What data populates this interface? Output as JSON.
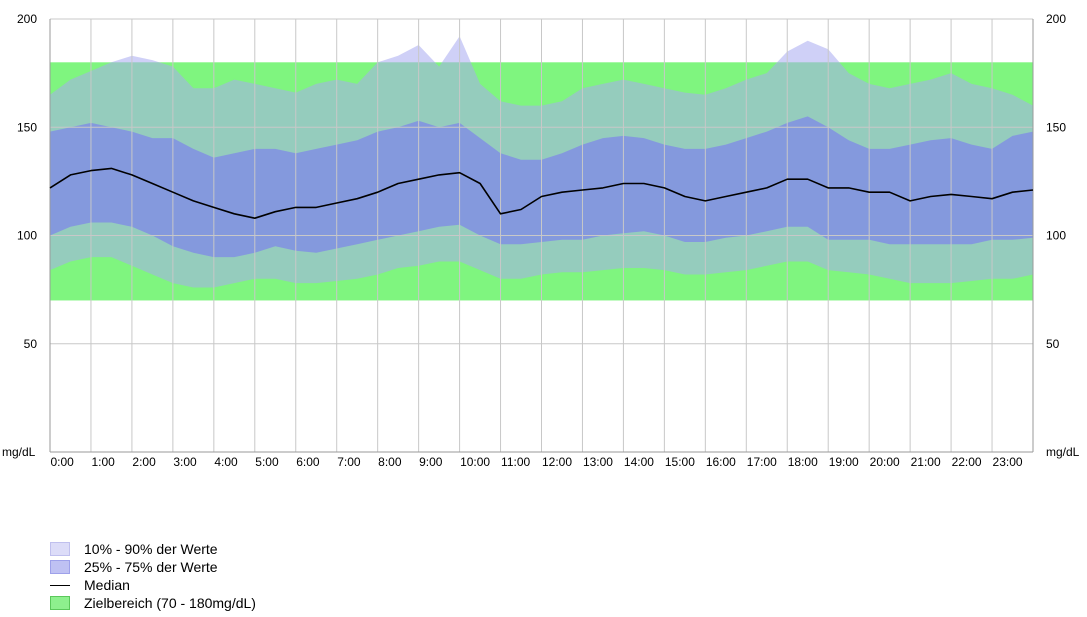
{
  "chart_data": {
    "type": "area",
    "ylim": [
      0,
      200
    ],
    "y_ticks": [
      200,
      150,
      100,
      50
    ],
    "y_unit_label": "mg/dL",
    "x_ticks": [
      "0:00",
      "1:00",
      "2:00",
      "3:00",
      "4:00",
      "5:00",
      "6:00",
      "7:00",
      "8:00",
      "9:00",
      "10:00",
      "11:00",
      "12:00",
      "13:00",
      "14:00",
      "15:00",
      "16:00",
      "17:00",
      "18:00",
      "19:00",
      "20:00",
      "21:00",
      "22:00",
      "23:00"
    ],
    "target_range": [
      70,
      180
    ],
    "hours": [
      0,
      0.5,
      1,
      1.5,
      2,
      2.5,
      3,
      3.5,
      4,
      4.5,
      5,
      5.5,
      6,
      6.5,
      7,
      7.5,
      8,
      8.5,
      9,
      9.5,
      10,
      10.5,
      11,
      11.5,
      12,
      12.5,
      13,
      13.5,
      14,
      14.5,
      15,
      15.5,
      16,
      16.5,
      17,
      17.5,
      18,
      18.5,
      19,
      19.5,
      20,
      20.5,
      21,
      21.5,
      22,
      22.5,
      23,
      23.5,
      24
    ],
    "p90": [
      165,
      172,
      176,
      180,
      183,
      181,
      178,
      168,
      168,
      172,
      170,
      168,
      166,
      170,
      172,
      170,
      180,
      183,
      188,
      178,
      192,
      170,
      162,
      160,
      160,
      162,
      168,
      170,
      172,
      170,
      168,
      166,
      165,
      168,
      172,
      175,
      185,
      190,
      186,
      175,
      170,
      168,
      170,
      172,
      175,
      170,
      168,
      165,
      160
    ],
    "p75": [
      148,
      150,
      152,
      150,
      148,
      145,
      145,
      140,
      136,
      138,
      140,
      140,
      138,
      140,
      142,
      144,
      148,
      150,
      153,
      150,
      152,
      145,
      138,
      135,
      135,
      138,
      142,
      145,
      146,
      145,
      142,
      140,
      140,
      142,
      145,
      148,
      152,
      155,
      150,
      144,
      140,
      140,
      142,
      144,
      145,
      142,
      140,
      146,
      148
    ],
    "median": [
      122,
      128,
      130,
      131,
      128,
      124,
      120,
      116,
      113,
      110,
      108,
      111,
      113,
      113,
      115,
      117,
      120,
      124,
      126,
      128,
      129,
      124,
      110,
      112,
      118,
      120,
      121,
      122,
      124,
      124,
      122,
      118,
      116,
      118,
      120,
      122,
      126,
      126,
      122,
      122,
      120,
      120,
      116,
      118,
      119,
      118,
      117,
      120,
      121
    ],
    "p25": [
      100,
      104,
      106,
      106,
      104,
      100,
      95,
      92,
      90,
      90,
      92,
      95,
      93,
      92,
      94,
      96,
      98,
      100,
      102,
      104,
      105,
      100,
      96,
      96,
      97,
      98,
      98,
      100,
      101,
      102,
      100,
      97,
      97,
      99,
      100,
      102,
      104,
      104,
      98,
      98,
      98,
      96,
      96,
      96,
      96,
      96,
      98,
      98,
      99
    ],
    "p10": [
      84,
      88,
      90,
      90,
      86,
      82,
      78,
      76,
      76,
      78,
      80,
      80,
      78,
      78,
      79,
      80,
      82,
      85,
      86,
      88,
      88,
      84,
      80,
      80,
      82,
      83,
      83,
      84,
      85,
      85,
      84,
      82,
      82,
      83,
      84,
      86,
      88,
      88,
      84,
      83,
      82,
      80,
      78,
      78,
      78,
      79,
      80,
      80,
      82
    ],
    "legend": [
      {
        "label": "10% - 90% der Werte",
        "color": "#d7d8f7"
      },
      {
        "label": "25% - 75% der Werte",
        "color": "#b9bbf2"
      },
      {
        "label": "Median",
        "color": "#000000"
      },
      {
        "label": "Zielbereich (70 - 180mg/dL)",
        "color": "#8ef08e"
      }
    ],
    "colors": {
      "target": "#7ff57f",
      "band_outer": "#a8aaf0",
      "band_inner": "#7f88e8",
      "grid": "#c8c8c8"
    }
  }
}
